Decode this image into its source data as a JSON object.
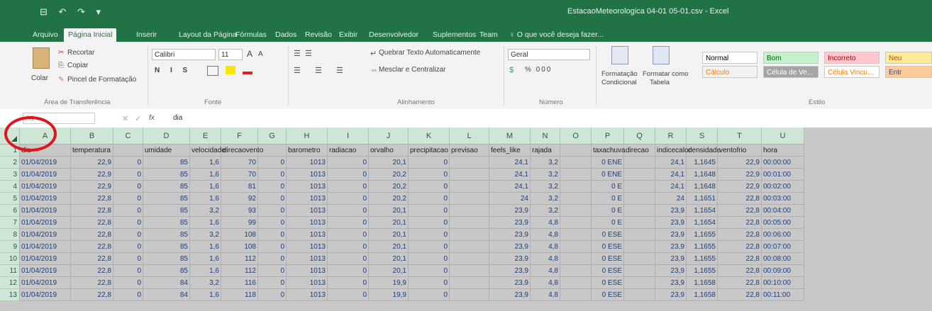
{
  "window": {
    "title": "EstacaoMeteorologica 04-01 05-01.csv - Excel",
    "quick_access": "⊟ ↶ ↷ ▾"
  },
  "tabs": [
    "Arquivo",
    "Página Inicial",
    "Inserir",
    "Layout da Página",
    "Fórmulas",
    "Dados",
    "Revisão",
    "Exibir",
    "Desenvolvedor",
    "Suplementos",
    "Team",
    "♀ O que você deseja fazer..."
  ],
  "ribbon": {
    "clipboard": {
      "paste": "Colar",
      "cut": "Recortar",
      "copy": "Copiar",
      "format_painter": "Pincel de Formatação",
      "group": "Área de Transferência"
    },
    "font": {
      "name": "Calibri",
      "size": "11",
      "grow": "A",
      "shrink": "A",
      "styles": "N I S",
      "group": "Fonte"
    },
    "alignment": {
      "wrap": "Quebrar Texto Automaticamente",
      "merge": "Mesclar e Centralizar",
      "group": "Alinhamento"
    },
    "number": {
      "format": "Geral",
      "symbols": "% 000",
      "group": "Número"
    },
    "styles": {
      "conditional_1": "Formatação",
      "conditional_2": "Condicional",
      "table_1": "Formatar como",
      "table_2": "Tabela",
      "group": "Estilo",
      "normal": "Normal",
      "good": "Bom",
      "bad": "Incorreto",
      "neutral": "Neu",
      "calc": "Cálculo",
      "check": "Célula de Ve...",
      "linked": "Célula Vincu...",
      "input": "Entr"
    }
  },
  "formula_bar": {
    "name_box": "A1",
    "fx": "fx",
    "content": "dia"
  },
  "columns": [
    "A",
    "B",
    "C",
    "D",
    "E",
    "F",
    "G",
    "H",
    "I",
    "J",
    "K",
    "L",
    "M",
    "N",
    "O",
    "P",
    "Q",
    "R",
    "S",
    "T",
    "U"
  ],
  "header_row": [
    "dia",
    "temperatura",
    "",
    "umidade",
    "velocidade",
    "direcaovento",
    "",
    "barometro",
    "radiacao",
    "orvalho",
    "precipitacao",
    "previsao",
    "feels_like",
    "rajada",
    "",
    "taxachuva",
    "direcao",
    "indicecalor",
    "densidade",
    "ventofrio",
    "hora"
  ],
  "rows": [
    {
      "n": "2",
      "c": [
        "01/04/2019",
        "22,9",
        "0",
        "85",
        "1,6",
        "70",
        "0",
        "1013",
        "0",
        "20,1",
        "0",
        "",
        "24,1",
        "3,2",
        "",
        "0 ENE",
        "",
        "24,1",
        "1,1645",
        "22,9",
        "00:00:00"
      ]
    },
    {
      "n": "3",
      "c": [
        "01/04/2019",
        "22,9",
        "0",
        "85",
        "1,6",
        "70",
        "0",
        "1013",
        "0",
        "20,2",
        "0",
        "",
        "24,1",
        "3,2",
        "",
        "0 ENE",
        "",
        "24,1",
        "1,1648",
        "22,9",
        "00:01:00"
      ]
    },
    {
      "n": "4",
      "c": [
        "01/04/2019",
        "22,9",
        "0",
        "85",
        "1,6",
        "81",
        "0",
        "1013",
        "0",
        "20,2",
        "0",
        "",
        "24,1",
        "3,2",
        "",
        "0 E",
        "",
        "24,1",
        "1,1648",
        "22,9",
        "00:02:00"
      ]
    },
    {
      "n": "5",
      "c": [
        "01/04/2019",
        "22,8",
        "0",
        "85",
        "1,6",
        "92",
        "0",
        "1013",
        "0",
        "20,2",
        "0",
        "",
        "24",
        "3,2",
        "",
        "0 E",
        "",
        "24",
        "1,1651",
        "22,8",
        "00:03:00"
      ]
    },
    {
      "n": "6",
      "c": [
        "01/04/2019",
        "22,8",
        "0",
        "85",
        "3,2",
        "93",
        "0",
        "1013",
        "0",
        "20,1",
        "0",
        "",
        "23,9",
        "3,2",
        "",
        "0 E",
        "",
        "23,9",
        "1,1654",
        "22,8",
        "00:04:00"
      ]
    },
    {
      "n": "7",
      "c": [
        "01/04/2019",
        "22,8",
        "0",
        "85",
        "1,6",
        "99",
        "0",
        "1013",
        "0",
        "20,1",
        "0",
        "",
        "23,9",
        "4,8",
        "",
        "0 E",
        "",
        "23,9",
        "1,1654",
        "22,8",
        "00:05:00"
      ]
    },
    {
      "n": "8",
      "c": [
        "01/04/2019",
        "22,8",
        "0",
        "85",
        "3,2",
        "108",
        "0",
        "1013",
        "0",
        "20,1",
        "0",
        "",
        "23,9",
        "4,8",
        "",
        "0 ESE",
        "",
        "23,9",
        "1,1655",
        "22,8",
        "00:06:00"
      ]
    },
    {
      "n": "9",
      "c": [
        "01/04/2019",
        "22,8",
        "0",
        "85",
        "1,6",
        "108",
        "0",
        "1013",
        "0",
        "20,1",
        "0",
        "",
        "23,9",
        "4,8",
        "",
        "0 ESE",
        "",
        "23,9",
        "1,1655",
        "22,8",
        "00:07:00"
      ]
    },
    {
      "n": "10",
      "c": [
        "01/04/2019",
        "22,8",
        "0",
        "85",
        "1,6",
        "112",
        "0",
        "1013",
        "0",
        "20,1",
        "0",
        "",
        "23,9",
        "4,8",
        "",
        "0 ESE",
        "",
        "23,9",
        "1,1655",
        "22,8",
        "00:08:00"
      ]
    },
    {
      "n": "11",
      "c": [
        "01/04/2019",
        "22,8",
        "0",
        "85",
        "1,6",
        "112",
        "0",
        "1013",
        "0",
        "20,1",
        "0",
        "",
        "23,9",
        "4,8",
        "",
        "0 ESE",
        "",
        "23,9",
        "1,1655",
        "22,8",
        "00:09:00"
      ]
    },
    {
      "n": "12",
      "c": [
        "01/04/2019",
        "22,8",
        "0",
        "84",
        "3,2",
        "116",
        "0",
        "1013",
        "0",
        "19,9",
        "0",
        "",
        "23,9",
        "4,8",
        "",
        "0 ESE",
        "",
        "23,9",
        "1,1658",
        "22,8",
        "00:10:00"
      ]
    },
    {
      "n": "13",
      "c": [
        "01/04/2019",
        "22,8",
        "0",
        "84",
        "1,6",
        "118",
        "0",
        "1013",
        "0",
        "19,9",
        "0",
        "",
        "23,9",
        "4,8",
        "",
        "0 ESE",
        "",
        "23,9",
        "1,1658",
        "22,8",
        "00:11:00"
      ]
    }
  ],
  "colors": {
    "excel_green": "#217346",
    "annotation_circle": "#e0141b"
  }
}
